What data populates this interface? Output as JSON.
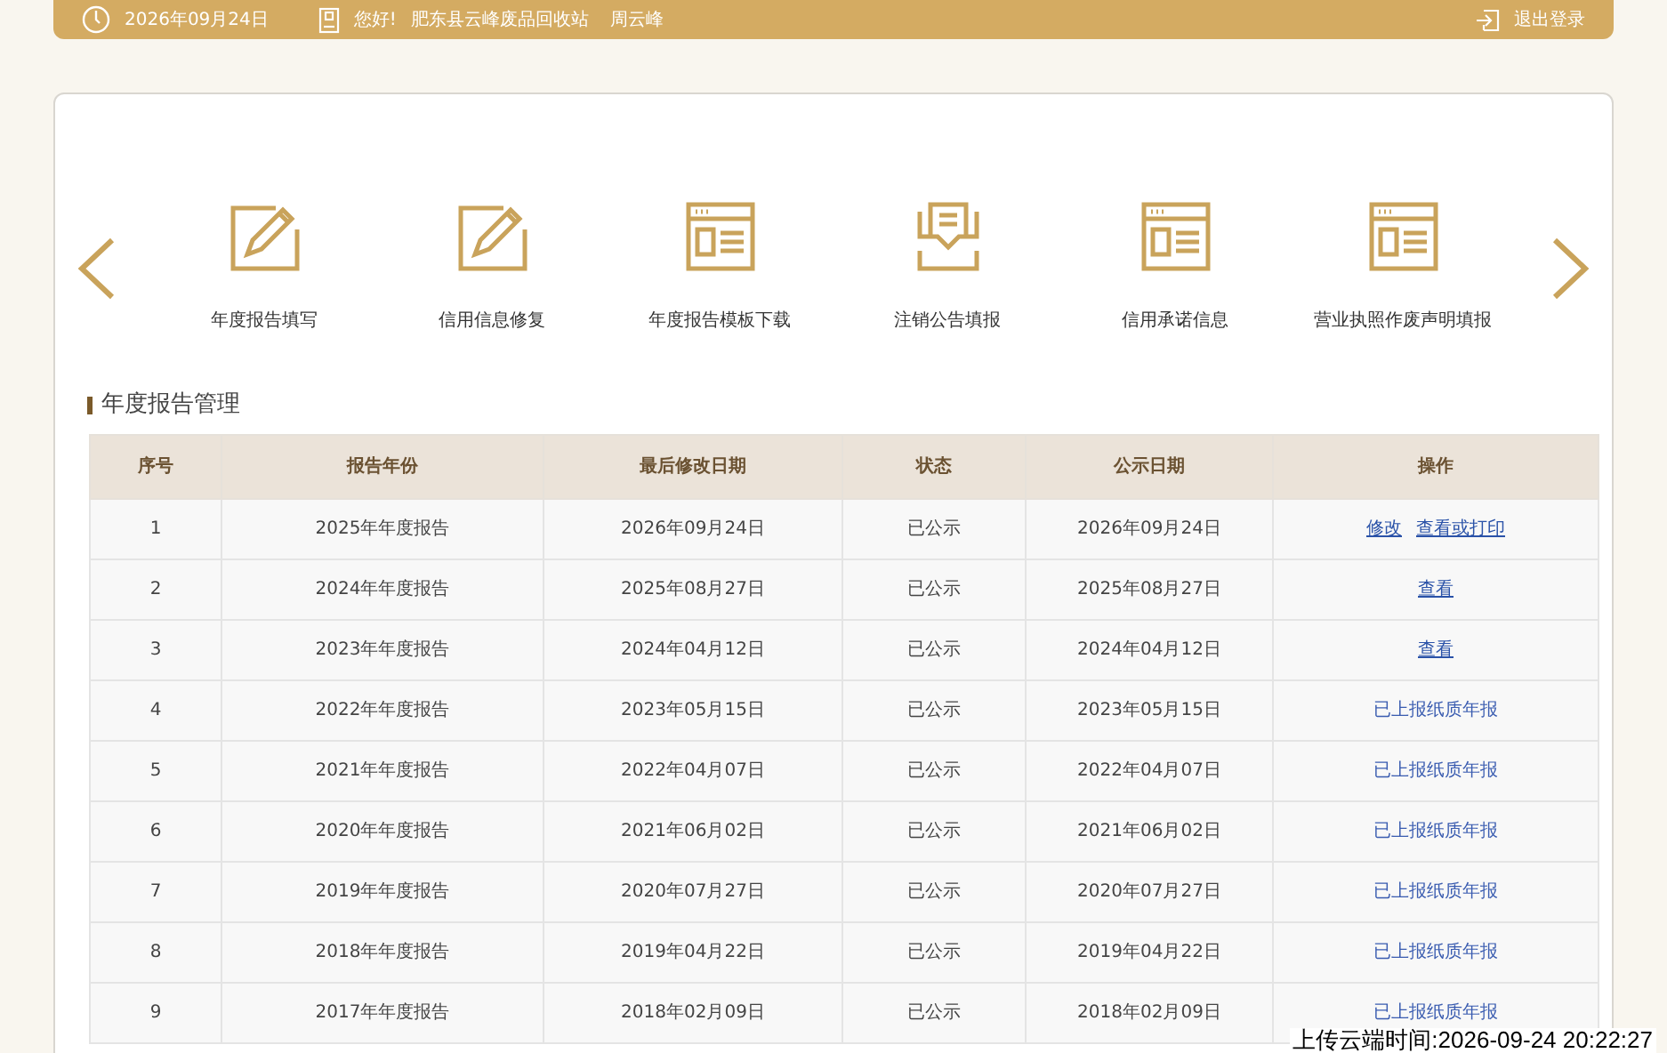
{
  "top_bar": {
    "date": "2026年09月24日",
    "greeting": "您好!",
    "company": "肥东县云峰废品回收站",
    "user": "周云峰",
    "logout": "退出登录"
  },
  "shortcuts": [
    {
      "label": "年度报告填写",
      "kind": "edit"
    },
    {
      "label": "信用信息修复",
      "kind": "edit"
    },
    {
      "label": "年度报告模板下载",
      "kind": "window"
    },
    {
      "label": "注销公告填报",
      "kind": "tray"
    },
    {
      "label": "信用承诺信息",
      "kind": "window"
    },
    {
      "label": "营业执照作废声明填报",
      "kind": "window"
    }
  ],
  "section_title": "年度报告管理",
  "table": {
    "columns": [
      "序号",
      "报告年份",
      "最后修改日期",
      "状态",
      "公示日期",
      "操作"
    ],
    "rows": [
      {
        "cells": [
          "1",
          "2025年年度报告",
          "2026年09月24日",
          "已公示",
          "2026年09月24日"
        ],
        "actions": [
          {
            "label": "修改",
            "kind": "link"
          },
          {
            "label": "查看或打印",
            "kind": "link"
          }
        ]
      },
      {
        "cells": [
          "2",
          "2024年年度报告",
          "2025年08月27日",
          "已公示",
          "2025年08月27日"
        ],
        "actions": [
          {
            "label": "查看",
            "kind": "link"
          }
        ]
      },
      {
        "cells": [
          "3",
          "2023年年度报告",
          "2024年04月12日",
          "已公示",
          "2024年04月12日"
        ],
        "actions": [
          {
            "label": "查看",
            "kind": "link"
          }
        ]
      },
      {
        "cells": [
          "4",
          "2022年年度报告",
          "2023年05月15日",
          "已公示",
          "2023年05月15日"
        ],
        "actions": [
          {
            "label": "已上报纸质年报",
            "kind": "text"
          }
        ]
      },
      {
        "cells": [
          "5",
          "2021年年度报告",
          "2022年04月07日",
          "已公示",
          "2022年04月07日"
        ],
        "actions": [
          {
            "label": "已上报纸质年报",
            "kind": "text"
          }
        ]
      },
      {
        "cells": [
          "6",
          "2020年年度报告",
          "2021年06月02日",
          "已公示",
          "2021年06月02日"
        ],
        "actions": [
          {
            "label": "已上报纸质年报",
            "kind": "text"
          }
        ]
      },
      {
        "cells": [
          "7",
          "2019年年度报告",
          "2020年07月27日",
          "已公示",
          "2020年07月27日"
        ],
        "actions": [
          {
            "label": "已上报纸质年报",
            "kind": "text"
          }
        ]
      },
      {
        "cells": [
          "8",
          "2018年年度报告",
          "2019年04月22日",
          "已公示",
          "2019年04月22日"
        ],
        "actions": [
          {
            "label": "已上报纸质年报",
            "kind": "text"
          }
        ]
      },
      {
        "cells": [
          "9",
          "2017年年度报告",
          "2018年02月09日",
          "已公示",
          "2018年02月09日"
        ],
        "actions": [
          {
            "label": "已上报纸质年报",
            "kind": "text"
          }
        ]
      }
    ]
  },
  "upload_stamp": "上传云端时间:2026-09-24 20:22:27"
}
